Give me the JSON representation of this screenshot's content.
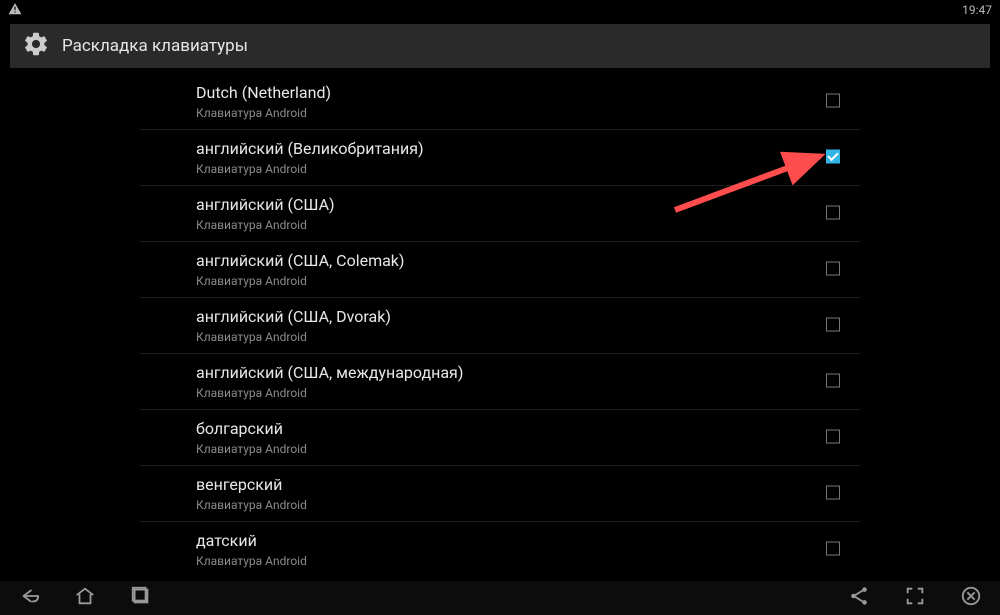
{
  "statusbar": {
    "time": "19:47"
  },
  "header": {
    "title": "Раскладка клавиатуры"
  },
  "list": {
    "items": [
      {
        "title": "Dutch (Netherland)",
        "sub": "Клавиатура Android",
        "checked": false
      },
      {
        "title": "английский (Великобритания)",
        "sub": "Клавиатура Android",
        "checked": true
      },
      {
        "title": "английский (США)",
        "sub": "Клавиатура Android",
        "checked": false
      },
      {
        "title": "английский (США, Colemak)",
        "sub": "Клавиатура Android",
        "checked": false
      },
      {
        "title": "английский (США, Dvorak)",
        "sub": "Клавиатура Android",
        "checked": false
      },
      {
        "title": "английский (США, международная)",
        "sub": "Клавиатура Android",
        "checked": false
      },
      {
        "title": "болгарский",
        "sub": "Клавиатура Android",
        "checked": false
      },
      {
        "title": "венгерский",
        "sub": "Клавиатура Android",
        "checked": false
      },
      {
        "title": "датский",
        "sub": "Клавиатура Android",
        "checked": false
      }
    ]
  }
}
